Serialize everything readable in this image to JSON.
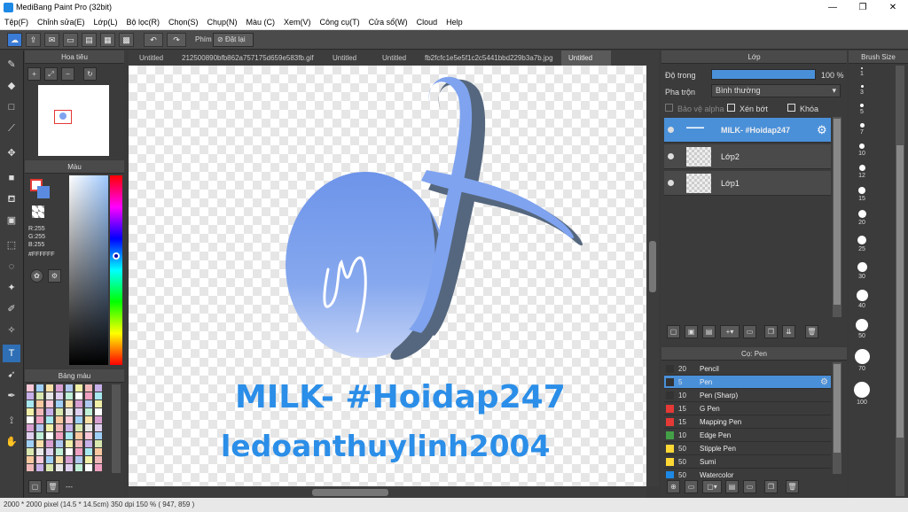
{
  "window": {
    "title": "MediBang Paint Pro (32bit)",
    "minimize": "—",
    "maximize": "❐",
    "close": "✕"
  },
  "menu": [
    "Tệp(F)",
    "Chỉnh sửa(E)",
    "Lớp(L)",
    "Bộ lọc(R)",
    "Chọn(S)",
    "Chụp(N)",
    "Màu (C)",
    "Xem(V)",
    "Công cụ(T)",
    "Cửa sổ(W)",
    "Cloud",
    "Help"
  ],
  "toolbar": {
    "label": "Phím",
    "reset_label": "Đặt lại"
  },
  "tabs": [
    {
      "label": "Untitled",
      "active": false
    },
    {
      "label": "212500890bfb862a757175d659e583fb.gif",
      "active": false
    },
    {
      "label": "Untitled",
      "active": false
    },
    {
      "label": "Untitled",
      "active": false
    },
    {
      "label": "fb2fcfc1e5e5f1c2c5441bbd229b3a7b.jpg",
      "active": false
    },
    {
      "label": "Untitled",
      "active": true
    }
  ],
  "navigator": {
    "title": "Hoa tiêu"
  },
  "color_panel": {
    "title": "Màu",
    "r": "R:255",
    "g": "G:255",
    "b": "B:255",
    "hex": "#FFFFFF"
  },
  "palette": {
    "title": "Bảng màu",
    "footer": "---"
  },
  "layer_panel": {
    "title": "Lớp",
    "opacity_label": "Độ trong",
    "opacity_value": "100 %",
    "opacity": 1.0,
    "blend_label": "Pha trộn",
    "blend_value": "Bình thường",
    "protect_alpha": "Bảo vệ alpha",
    "clip": "Xén bớt",
    "lock": "Khóa",
    "layers": [
      {
        "name": "MILK- #Hoidap247",
        "selected": true
      },
      {
        "name": "Lớp2",
        "selected": false
      },
      {
        "name": "Lớp1",
        "selected": false
      }
    ]
  },
  "brush_panel": {
    "title": "Cọ: Pen",
    "brushes": [
      {
        "size": "20",
        "name": "Pencil",
        "color": "#333333",
        "selected": false
      },
      {
        "size": "5",
        "name": "Pen",
        "color": "#333333",
        "selected": true
      },
      {
        "size": "10",
        "name": "Pen (Sharp)",
        "color": "#333333",
        "selected": false
      },
      {
        "size": "15",
        "name": "G Pen",
        "color": "#e53935",
        "selected": false
      },
      {
        "size": "15",
        "name": "Mapping Pen",
        "color": "#e53935",
        "selected": false
      },
      {
        "size": "10",
        "name": "Edge Pen",
        "color": "#43a047",
        "selected": false
      },
      {
        "size": "50",
        "name": "Stipple Pen",
        "color": "#fdd835",
        "selected": false
      },
      {
        "size": "50",
        "name": "Sumi",
        "color": "#fdd835",
        "selected": false
      },
      {
        "size": "50",
        "name": "Watercolor",
        "color": "#1e88e5",
        "selected": false
      }
    ]
  },
  "brush_size": {
    "title": "Brush Size",
    "sizes": [
      "1",
      "3",
      "5",
      "7",
      "10",
      "12",
      "15",
      "20",
      "25",
      "30",
      "40",
      "50",
      "70",
      "100"
    ]
  },
  "canvas": {
    "text_line1": "MILK- #Hoidap247",
    "text_line2": "ledoanthuylinh2004",
    "text_color": "#2b8ee8",
    "blob_color": "#7fa3ef"
  },
  "status": "2000 * 2000 pixel   (14.5 * 14.5cm)   350 dpi   150 %   ( 947, 859 )"
}
